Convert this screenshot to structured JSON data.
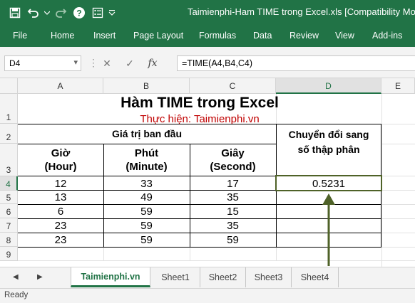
{
  "window": {
    "title": "Taimienphi-Ham TIME trong Excel.xls  [Compatibility Mode]"
  },
  "qat": {
    "save_icon": "save-icon",
    "undo_icon": "undo-icon",
    "redo_icon": "redo-icon",
    "help_icon": "help-icon",
    "form_icon": "form-icon",
    "customize_icon": "customize-qat-icon"
  },
  "ribbon": {
    "tabs": [
      "File",
      "Home",
      "Insert",
      "Page Layout",
      "Formulas",
      "Data",
      "Review",
      "View",
      "Add-ins"
    ]
  },
  "formula_bar": {
    "name_box": "D4",
    "fx": "fx",
    "formula": "=TIME(A4,B4,C4)"
  },
  "columns": [
    "A",
    "B",
    "C",
    "D",
    "E"
  ],
  "rows": [
    "1",
    "2",
    "3",
    "4",
    "5",
    "6",
    "7",
    "8",
    "9"
  ],
  "sheet": {
    "title": "Hàm TIME trong Excel",
    "subtitle": "Thực hiện: Taimienphi.vn",
    "group_header": "Giá trị ban đầu",
    "hdr_hour": "Giờ",
    "hdr_hour_en": "(Hour)",
    "hdr_minute": "Phút",
    "hdr_minute_en": "(Minute)",
    "hdr_second": "Giây",
    "hdr_second_en": "(Second)",
    "hdr_convert_1": "Chuyển đổi sang",
    "hdr_convert_2": "số thập phân",
    "data": [
      [
        "12",
        "33",
        "17",
        "0.5231"
      ],
      [
        "13",
        "49",
        "35",
        ""
      ],
      [
        "6",
        "59",
        "15",
        ""
      ],
      [
        "23",
        "59",
        "35",
        ""
      ],
      [
        "23",
        "59",
        "59",
        ""
      ]
    ]
  },
  "sheet_tabs": {
    "nav_prev": "◀",
    "nav_next": "▶",
    "tabs": [
      "Taimienphi.vn",
      "Sheet1",
      "Sheet2",
      "Sheet3",
      "Sheet4"
    ],
    "active": "Taimienphi.vn"
  },
  "status": {
    "text": "Ready"
  },
  "colors": {
    "excel_green": "#217346",
    "subtitle_red": "#c00000",
    "arrow_green": "#4f6228",
    "border_olive": "#4f6228"
  }
}
